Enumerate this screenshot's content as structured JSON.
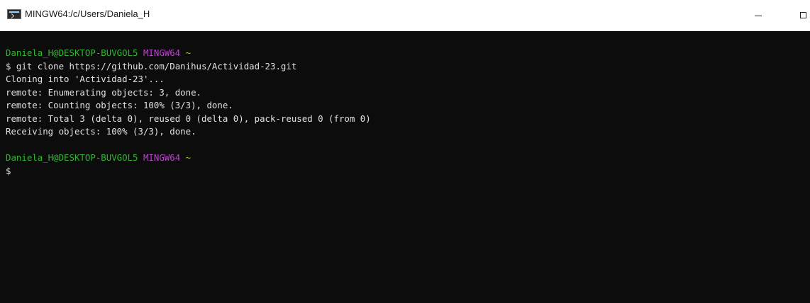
{
  "window": {
    "title": "MINGW64:/c/Users/Daniela_H",
    "icon": "terminal-icon",
    "controls": [
      "minimize",
      "maximize"
    ]
  },
  "terminal": {
    "colors": {
      "background": "#0c0c0c",
      "text": "#e2e2e2",
      "user_host": "#2fb82f",
      "msystem": "#b548c6",
      "path": "#c7c12a"
    },
    "prompt1": {
      "user_host": "Daniela_H@DESKTOP-BUVGOL5",
      "msystem": "MINGW64",
      "path": "~"
    },
    "command_line": "$ git clone https://github.com/Danihus/Actividad-23.git",
    "output": [
      "Cloning into 'Actividad-23'...",
      "remote: Enumerating objects: 3, done.",
      "remote: Counting objects: 100% (3/3), done.",
      "remote: Total 3 (delta 0), reused 0 (delta 0), pack-reused 0 (from 0)",
      "Receiving objects: 100% (3/3), done."
    ],
    "prompt2": {
      "user_host": "Daniela_H@DESKTOP-BUVGOL5",
      "msystem": "MINGW64",
      "path": "~"
    },
    "input_line": "$"
  }
}
